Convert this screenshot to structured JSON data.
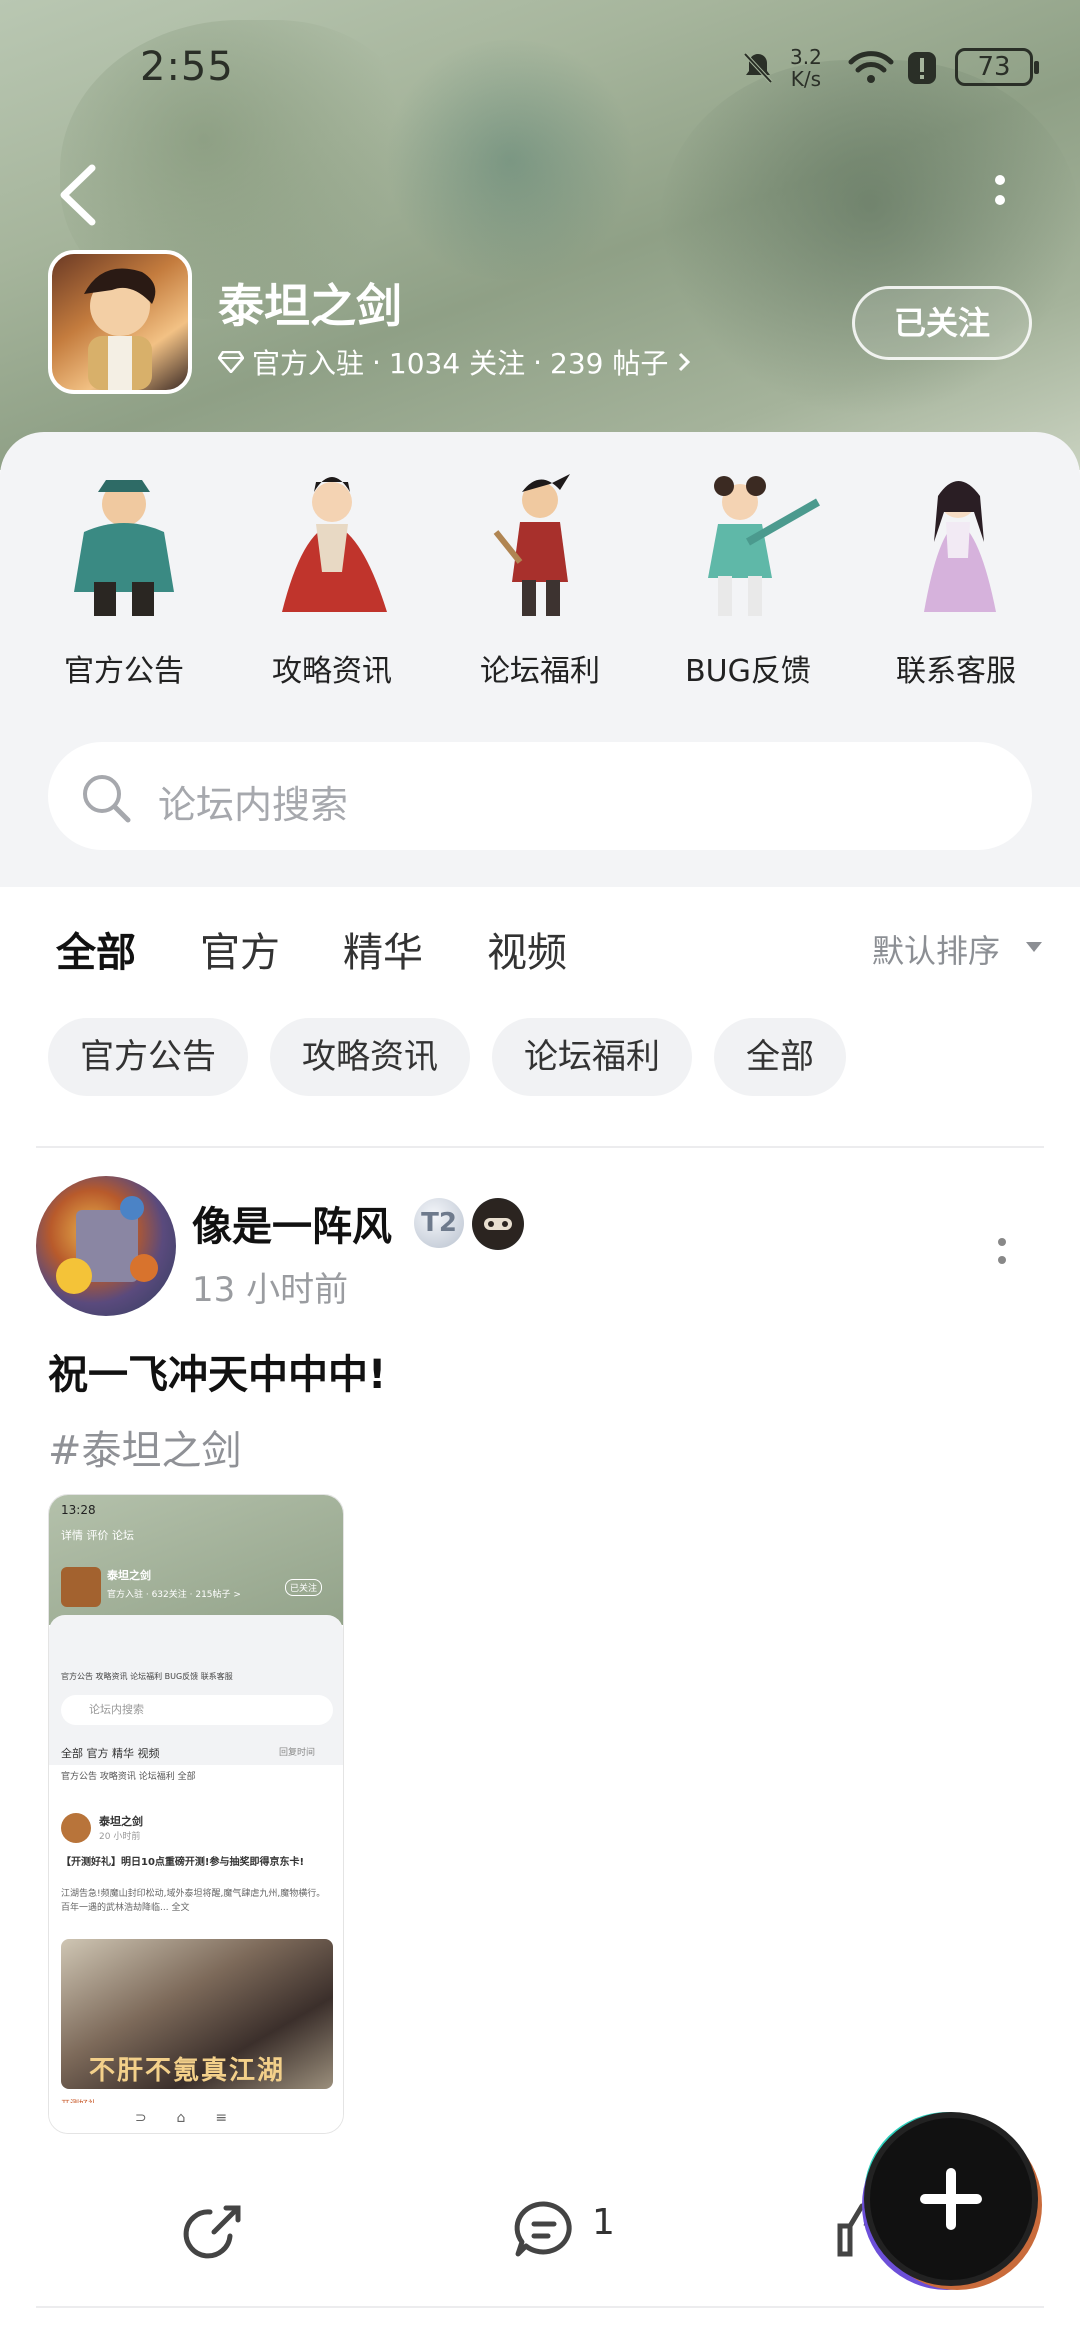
{
  "status_bar": {
    "time": "2:55",
    "net_speed": "3.2",
    "net_unit": "K/s",
    "battery": "73"
  },
  "forum": {
    "name": "泰坦之剑",
    "meta_badge": "官方入驻",
    "followers": "1034 关注",
    "posts": "239 帖子",
    "follow_label": "已关注"
  },
  "categories": [
    {
      "label": "官方公告",
      "icon": "character-warrior"
    },
    {
      "label": "攻略资讯",
      "icon": "character-lady-red"
    },
    {
      "label": "论坛福利",
      "icon": "character-swordsman"
    },
    {
      "label": "BUG反馈",
      "icon": "character-lancer"
    },
    {
      "label": "联系客服",
      "icon": "character-maiden"
    }
  ],
  "search": {
    "placeholder": "论坛内搜索"
  },
  "tabs": [
    {
      "label": "全部",
      "active": true
    },
    {
      "label": "官方",
      "active": false
    },
    {
      "label": "精华",
      "active": false
    },
    {
      "label": "视频",
      "active": false
    }
  ],
  "sort_label": "默认排序",
  "chips": [
    "官方公告",
    "攻略资讯",
    "论坛福利",
    "全部"
  ],
  "post": {
    "user": "像是一阵风",
    "level_badge": "T2",
    "time": "13 小时前",
    "title": "祝一飞冲天中中中!",
    "tag": "#泰坦之剑",
    "comment_count": "1",
    "screenshot": {
      "time": "13:28",
      "tabs": "详情  评价  论坛",
      "forum_name": "泰坦之剑",
      "forum_meta": "官方入驻 · 632关注 · 215帖子 >",
      "follow": "已关注",
      "cats": "官方公告  攻略资讯  论坛福利  BUG反馈  联系客服",
      "search": "论坛内搜索",
      "tabs2": "全部  官方  精华  视频",
      "sort": "回复时间",
      "chips": "官方公告  攻略资讯  论坛福利  全部",
      "post_user": "泰坦之剑",
      "post_time": "20 小时前",
      "post_title": "【开测好礼】明日10点重磅开测!参与抽奖即得京东卡!",
      "post_body": "江湖告急!频魔山封印松动,域外泰坦将醒,魔气肆虐九州,魔物横行。百年一遇的武林浩劫降临... 全文",
      "img_title": "不肝不氪真江湖",
      "tag": "开测好礼",
      "nav": "⊃⌂≡"
    }
  },
  "colors": {
    "accent": "#2ec8b6",
    "sheet_bg": "#f3f4f6",
    "banner": "#a6b59c"
  }
}
